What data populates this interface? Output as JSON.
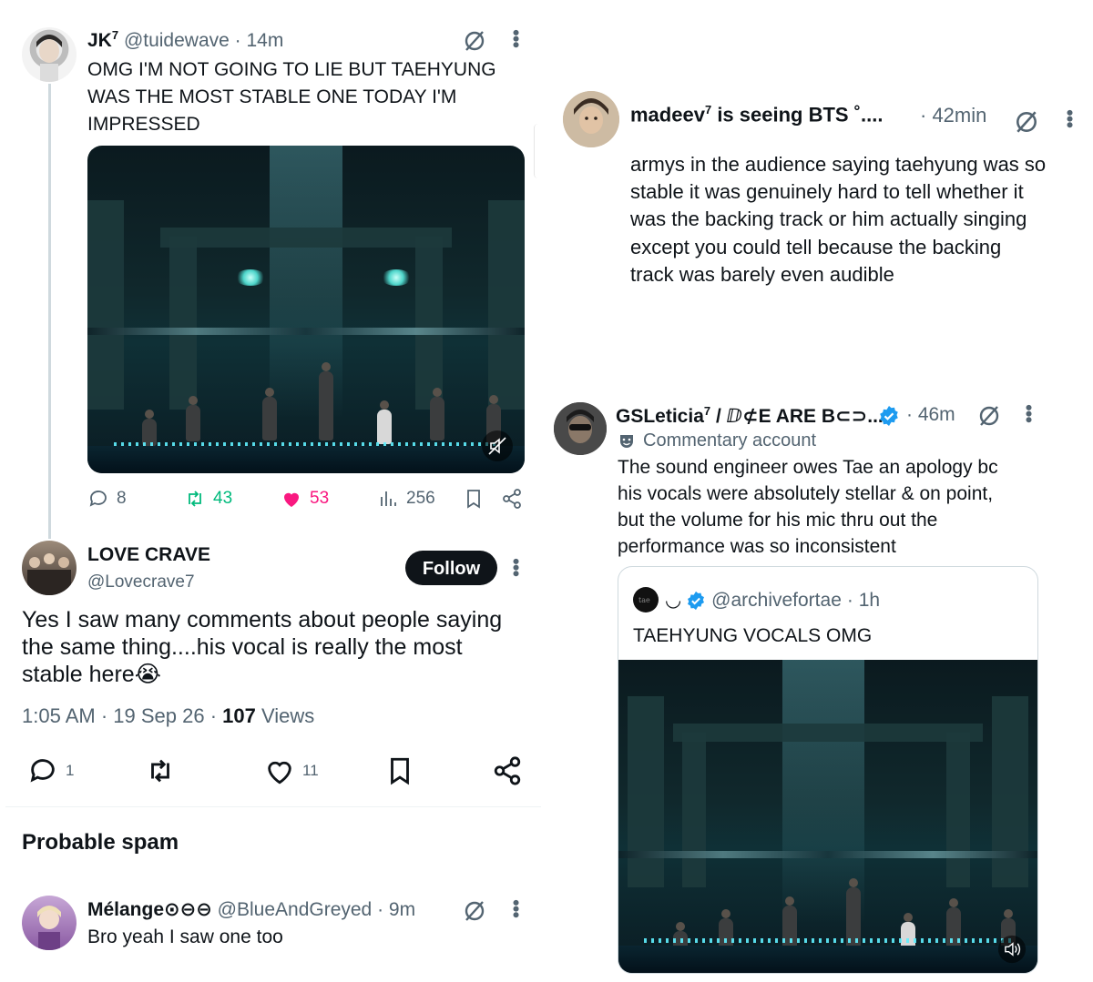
{
  "left": {
    "tweet1": {
      "name": "JK",
      "superscript": "7",
      "handle": "@tuidewave",
      "time": "· 14m",
      "text_line1": "OMG I'M NOT GOING TO LIE BUT TAEHYUNG",
      "text_line2": "WAS THE MOST STABLE ONE TODAY I'M",
      "text_line3": "IMPRESSED",
      "replies": "8",
      "retweets": "43",
      "likes": "53",
      "views": "256"
    },
    "tweet2": {
      "name": "LOVE CRAVE",
      "handle": "@Lovecrave7",
      "follow_label": "Follow",
      "text_line1": "Yes I saw many comments about people saying",
      "text_line2": "the same thing....his vocal is really the most",
      "text_line3": "stable here😭",
      "time": "1:05 AM",
      "date": "19 Sep 26",
      "views_count": "107",
      "views_label": "Views",
      "replies": "1",
      "likes": "11"
    },
    "spam_heading": "Probable spam",
    "tweet3": {
      "name": "Mélange⊙⊖⊖",
      "handle": "@BlueAndGreyed",
      "time": "· 9m",
      "text": "Bro yeah I saw one too"
    }
  },
  "right": {
    "tweet1": {
      "name": "madeev",
      "superscript": "7",
      "name_suffix": "is seeing BTS ˚....",
      "time": "· 42min",
      "text_line1": "armys in the audience saying taehyung was so",
      "text_line2": "stable it was genuinely hard to tell whether it",
      "text_line3": "was the backing track or him actually singing",
      "text_line4": "except you could tell because the backing",
      "text_line5": "track was barely even audible"
    },
    "tweet2": {
      "name": "GSLeticia",
      "superscript": "7",
      "name_suffix": "/ ⅅ⊄E ARE B⊂⊃...",
      "time": "· 46m",
      "label": "Commentary account",
      "text_line1": "The sound engineer owes Tae an apology bc",
      "text_line2": "his vocals were absolutely stellar & on point,",
      "text_line3": "but the volume for his mic thru out the",
      "text_line4": "performance was so inconsistent",
      "quote": {
        "name": "◡",
        "handle": "@archivefortae",
        "time": "· 1h",
        "text": "TAEHYUNG VOCALS OMG"
      }
    }
  },
  "colors": {
    "text": "#0f1419",
    "muted": "#536471",
    "retweet_green": "#00ba7c",
    "like_pink": "#f91880",
    "verified_blue": "#1d9bf0"
  }
}
